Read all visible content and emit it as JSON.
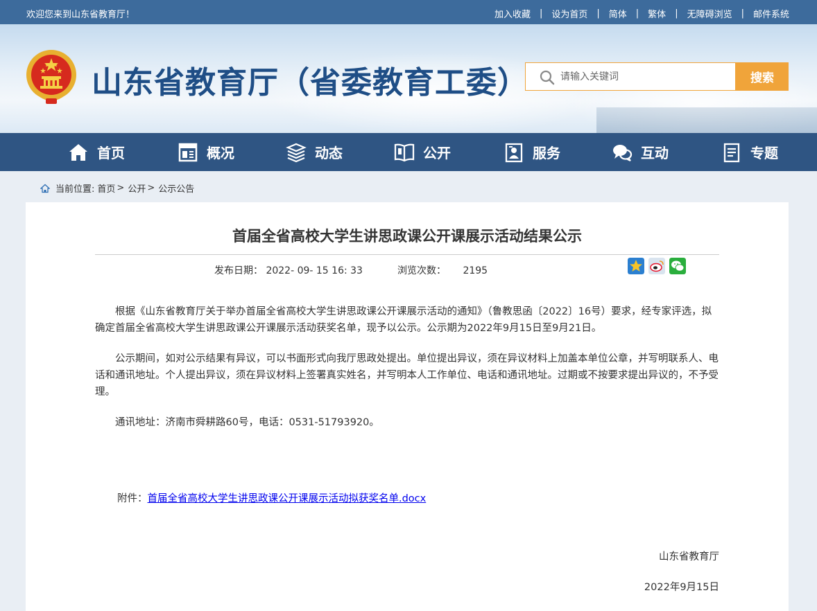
{
  "topbar": {
    "welcome": "欢迎您来到山东省教育厅！",
    "links": [
      "加入收藏",
      "设为首页",
      "简体",
      "繁体",
      "无障碍浏览",
      "邮件系统"
    ],
    "separator": "|"
  },
  "header": {
    "site_title": "山东省教育厅（省委教育工委）",
    "search_placeholder": "请输入关键词",
    "search_button": "搜索"
  },
  "nav": {
    "items": [
      {
        "label": "首页",
        "icon": "home-icon"
      },
      {
        "label": "概况",
        "icon": "overview-icon"
      },
      {
        "label": "动态",
        "icon": "news-icon"
      },
      {
        "label": "公开",
        "icon": "book-icon"
      },
      {
        "label": "服务",
        "icon": "service-icon"
      },
      {
        "label": "互动",
        "icon": "chat-icon"
      },
      {
        "label": "专题",
        "icon": "topic-icon"
      }
    ]
  },
  "breadcrumb": {
    "prefix": "当前位置:",
    "items": [
      "首页",
      "公开",
      "公示公告"
    ],
    "arrow": ">"
  },
  "article": {
    "title": "首届全省高校大学生讲思政课公开课展示活动结果公示",
    "publish_label": "发布日期：",
    "publish_date": "2022- 09- 15 16: 33",
    "views_label": "浏览次数：",
    "views": "2195",
    "paragraphs": [
      "根据《山东省教育厅关于举办首届全省高校大学生讲思政课公开课展示活动的通知》（鲁教思函〔2022〕16号）要求，经专家评选，拟确定首届全省高校大学生讲思政课公开课展示活动获奖名单，现予以公示。公示期为2022年9月15日至9月21日。",
      "公示期间，如对公示结果有异议，可以书面形式向我厅思政处提出。单位提出异议，须在异议材料上加盖本单位公章，并写明联系人、电话和通讯地址。个人提出异议，须在异议材料上签署真实姓名，并写明本人工作单位、电话和通讯地址。过期或不按要求提出异议的，不予受理。",
      "通讯地址：济南市舜耕路60号，电话：0531-51793920。"
    ],
    "attachment_label": "附件：",
    "attachment_link": "首届全省高校大学生讲思政课公开课展示活动拟获奖名单.docx",
    "signature": "山东省教育厅",
    "sign_date": "2022年9月15日"
  },
  "share_icons": [
    "qzone-icon",
    "weibo-icon",
    "wechat-icon"
  ],
  "colors": {
    "topbar": "#3d6b9c",
    "nav": "#2f5583",
    "accent": "#f0a43a",
    "title": "#1f4e86"
  }
}
